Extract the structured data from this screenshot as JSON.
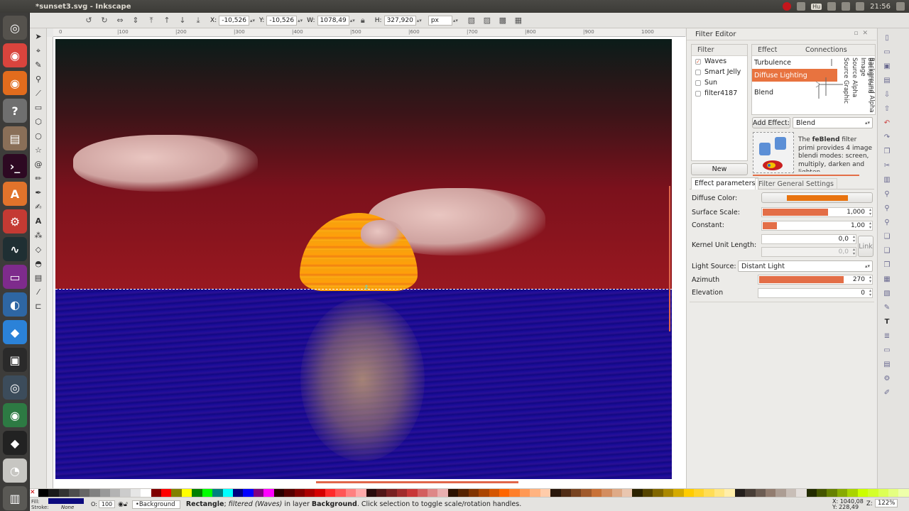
{
  "window": {
    "title": "*sunset3.svg - Inkscape",
    "clock": "21:56",
    "keyboard": "Hu"
  },
  "launcher": [
    {
      "name": "ubuntu-dash-icon",
      "glyph": "◎",
      "bg": "#55524d"
    },
    {
      "name": "chrome-icon",
      "glyph": "◉",
      "bg": "#d9443d"
    },
    {
      "name": "firefox-icon",
      "glyph": "◉",
      "bg": "#e26c1d"
    },
    {
      "name": "help-icon",
      "glyph": "?",
      "bg": "#6f6f6f"
    },
    {
      "name": "files-icon",
      "glyph": "▤",
      "bg": "#8a6f58"
    },
    {
      "name": "terminal-icon",
      "glyph": "›_",
      "bg": "#2d0922"
    },
    {
      "name": "software-center-icon",
      "glyph": "A",
      "bg": "#e1732b"
    },
    {
      "name": "system-settings-icon",
      "glyph": "⚙",
      "bg": "#c43a33"
    },
    {
      "name": "system-monitor-icon",
      "glyph": "∿",
      "bg": "#1f2f33"
    },
    {
      "name": "display-icon",
      "glyph": "▭",
      "bg": "#7e2b8c"
    },
    {
      "name": "network-icon",
      "glyph": "◐",
      "bg": "#2e66a3"
    },
    {
      "name": "dropbox-icon",
      "glyph": "◆",
      "bg": "#2b82d8"
    },
    {
      "name": "app-icon",
      "glyph": "▣",
      "bg": "#2a2a2a"
    },
    {
      "name": "disk-icon",
      "glyph": "◎",
      "bg": "#3c4c5b"
    },
    {
      "name": "globe-icon",
      "glyph": "◉",
      "bg": "#2d7a43"
    },
    {
      "name": "inkscape-icon",
      "glyph": "◆",
      "bg": "#222222"
    },
    {
      "name": "clock-app-icon",
      "glyph": "◔",
      "bg": "#c7c6c2"
    },
    {
      "name": "trash-icon",
      "glyph": "▥",
      "bg": "#5a5955"
    }
  ],
  "commandbar": {
    "x_label": "X:",
    "x_value": "-10,526",
    "y_label": "Y:",
    "y_value": "-10,526",
    "w_label": "W:",
    "w_value": "1078,49",
    "h_label": "H:",
    "h_value": "327,920",
    "unit": "px"
  },
  "ruler_ticks": [
    "0",
    "|100",
    "|200",
    "|300",
    "|400",
    "|500",
    "|600",
    "|700",
    "|800",
    "|900",
    "1000"
  ],
  "dock": {
    "title": "Filter Editor",
    "filter_header": "Filter",
    "filters": [
      {
        "label": "Waves",
        "checked": true
      },
      {
        "label": "Smart Jelly",
        "checked": false
      },
      {
        "label": "Sun",
        "checked": false
      },
      {
        "label": "filter4187",
        "checked": false
      }
    ],
    "new_button": "New",
    "effect_header": "Effect",
    "connections_header": "Connections",
    "effects": [
      "Turbulence",
      "Diffuse Lighting",
      "Blend"
    ],
    "inputs": [
      "Source Graphic",
      "Source Alpha",
      "Background Image",
      "Background Alpha"
    ],
    "add_effect_button": "Add Effect:",
    "add_effect_value": "Blend",
    "description_prefix": "The ",
    "description_bold": "feBlend",
    "description_rest": " filter primi provides 4 image blendi modes: screen, multiply, darken and lighten.",
    "tab_effect_params": "Effect parameters",
    "tab_general": "Filter General Settings",
    "params": {
      "diffuse_color_label": "Diffuse Color:",
      "diffuse_color": "#e8730f",
      "surface_scale_label": "Surface Scale:",
      "surface_scale": "1,000",
      "surface_scale_fill": 0.6,
      "constant_label": "Constant:",
      "constant": "1,00",
      "constant_fill": 0.13,
      "kernel_label": "Kernel Unit Length:",
      "kernel_1": "0,0",
      "kernel_2": "0,0",
      "link_button": "Link",
      "light_source_label": "Light Source:",
      "light_source": "Distant Light",
      "azimuth_label": "Azimuth",
      "azimuth": "270",
      "azimuth_fill": 0.75,
      "elevation_label": "Elevation",
      "elevation": "0"
    }
  },
  "status": {
    "fill_label": "Fill:",
    "stroke_label": "Stroke:",
    "stroke_value": "None",
    "opacity_label": "O:",
    "opacity_value": "100",
    "layer": "•Background",
    "msg_bold": "Rectangle",
    "msg_1": "; ",
    "msg_italic": "filtered (Waves)",
    "msg_2": " in layer ",
    "msg_bold2": "Background",
    "msg_3": ". Click selection to toggle scale/rotation handles.",
    "coords_x": "X: 1040,08",
    "coords_y": "Y: 228,49",
    "zoom_label": "Z:",
    "zoom": "122%"
  },
  "palette": [
    "#000000",
    "#1a1a1a",
    "#333333",
    "#4d4d4d",
    "#666666",
    "#808080",
    "#999999",
    "#b3b3b3",
    "#cccccc",
    "#e6e6e6",
    "#ffffff",
    "#800000",
    "#ff0000",
    "#808000",
    "#ffff00",
    "#008000",
    "#00ff00",
    "#008080",
    "#00ffff",
    "#000080",
    "#0000ff",
    "#800080",
    "#ff00ff",
    "#2b0000",
    "#550000",
    "#800000",
    "#aa0000",
    "#d40000",
    "#ff2a2a",
    "#ff5555",
    "#ff8080",
    "#ffaaaa",
    "#280b0b",
    "#501616",
    "#782121",
    "#a02c2c",
    "#c83737",
    "#d35f5f",
    "#de8787",
    "#e9afaf",
    "#2b1100",
    "#552200",
    "#803300",
    "#aa4400",
    "#d45500",
    "#ff6600",
    "#ff7f2a",
    "#ff9955",
    "#ffb380",
    "#ffccaa",
    "#28170b",
    "#502d16",
    "#784421",
    "#a05a2c",
    "#c87137",
    "#d38d5f",
    "#deaa87",
    "#e9c6af",
    "#2b2200",
    "#554400",
    "#806600",
    "#aa8800",
    "#d4aa00",
    "#ffcc00",
    "#ffd42a",
    "#ffdd55",
    "#ffe680",
    "#ffeeaa",
    "#241f1c",
    "#483e37",
    "#6c5d53",
    "#917c6f",
    "#ac9d93",
    "#c8beb7",
    "#e3dedb",
    "#222b00",
    "#445500",
    "#668000",
    "#88aa00",
    "#aad400",
    "#ccff00",
    "#d4ff2a",
    "#ddff55",
    "#e5ff80",
    "#eeffaa"
  ]
}
